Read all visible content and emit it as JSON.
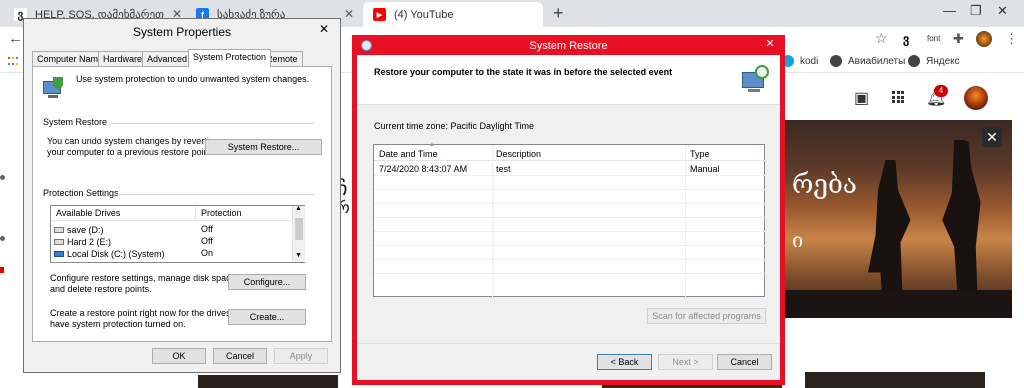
{
  "browser": {
    "tabs": [
      {
        "title": "HELP, SOS, დამეხმარეთ მოლ..",
        "icon": "georgian-site-icon"
      },
      {
        "title": "სახვაძე ზურა",
        "icon": "facebook-icon"
      },
      {
        "title": "(4) YouTube",
        "icon": "youtube-icon"
      }
    ],
    "bookmarks": [
      "kodi",
      "Авиабилеты",
      "Яндекс"
    ],
    "ext_label": "font",
    "notification_count": "4",
    "colors": {
      "tabstrip": "#dee1e6",
      "youtube_red": "#ff0000",
      "facebook_blue": "#1877f2"
    }
  },
  "system_properties": {
    "title": "System Properties",
    "tabs": [
      "Computer Name",
      "Hardware",
      "Advanced",
      "System Protection",
      "Remote"
    ],
    "selected_tab": "System Protection",
    "intro": "Use system protection to undo unwanted system changes.",
    "restore_group": "System Restore",
    "restore_text_1": "You can undo system changes by reverting",
    "restore_text_2": "your computer to a previous restore point.",
    "restore_button": "System Restore...",
    "protection_group": "Protection Settings",
    "drives_header": "Available Drives",
    "protection_header": "Protection",
    "drives": [
      {
        "name": "save (D:)",
        "protection": "Off"
      },
      {
        "name": "Hard 2 (E:)",
        "protection": "Off"
      },
      {
        "name": "Local Disk (C:) (System)",
        "protection": "On"
      }
    ],
    "configure_text_1": "Configure restore settings, manage disk space,",
    "configure_text_2": "and delete restore points.",
    "configure_button": "Configure...",
    "create_text_1": "Create a restore point right now for the drives that",
    "create_text_2": "have system protection turned on.",
    "create_button": "Create...",
    "ok": "OK",
    "cancel": "Cancel",
    "apply": "Apply"
  },
  "system_restore": {
    "title": "System Restore",
    "heading": "Restore your computer to the state it was in before the selected event",
    "timezone": "Current time zone: Pacific Daylight Time",
    "columns": [
      "Date and Time",
      "Description",
      "Type"
    ],
    "rows": [
      {
        "date": "7/24/2020 8:43:07 AM",
        "description": "test",
        "type": "Manual"
      }
    ],
    "scan_button": "Scan for affected programs",
    "back_button": "< Back",
    "next_button": "Next >",
    "cancel_button": "Cancel",
    "frame_color": "#e81123"
  },
  "youtube": {
    "banner_text_1": "რება",
    "banner_text_2": "ი",
    "banner_left_1": "ჩ",
    "banner_left_2": "რ"
  }
}
